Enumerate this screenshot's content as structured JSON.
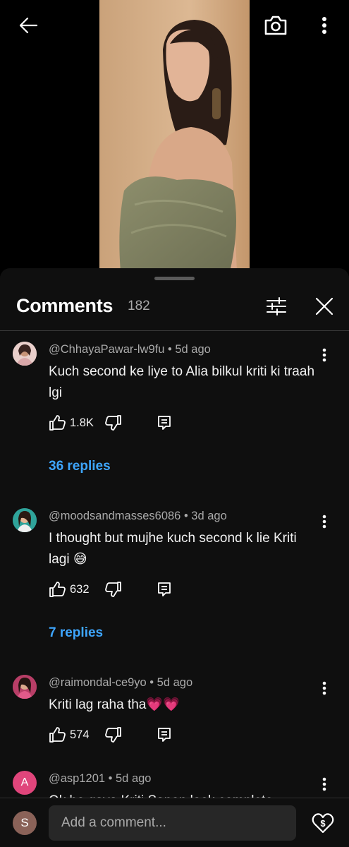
{
  "header": {
    "icons": [
      "back-arrow-icon",
      "camera-icon",
      "more-vertical-icon"
    ]
  },
  "comments_panel": {
    "title": "Comments",
    "count": "182",
    "icons": [
      "filter-sliders-icon",
      "close-icon"
    ]
  },
  "comments": [
    {
      "meta": "@ChhayaPawar-lw9fu • 5d ago",
      "text": "Kuch second ke liye to Alia bilkul kriti ki traah lgi",
      "likes": "1.8K",
      "replies": "36 replies"
    },
    {
      "meta": "@moodsandmasses6086 • 3d ago",
      "text": "I thought but mujhe kuch second k lie Kriti lagi 😅",
      "likes": "632",
      "replies": "7 replies"
    },
    {
      "meta": "@raimondal-ce9yo • 5d ago",
      "text": "Kriti lag raha tha💗💗",
      "likes": "574"
    },
    {
      "meta": "@asp1201 • 5d ago",
      "text": "Ok ho gaya Kriti Sanon look complete",
      "avatar_letter": "A"
    }
  ],
  "composer": {
    "avatar_letter": "S",
    "placeholder": "Add a comment..."
  },
  "colors": {
    "background": "#0f0f0f",
    "link_blue": "#3ea6ff",
    "secondary_text": "#aaaaaa",
    "avatar_a": "#e0457b",
    "avatar_s": "#8a6258"
  }
}
